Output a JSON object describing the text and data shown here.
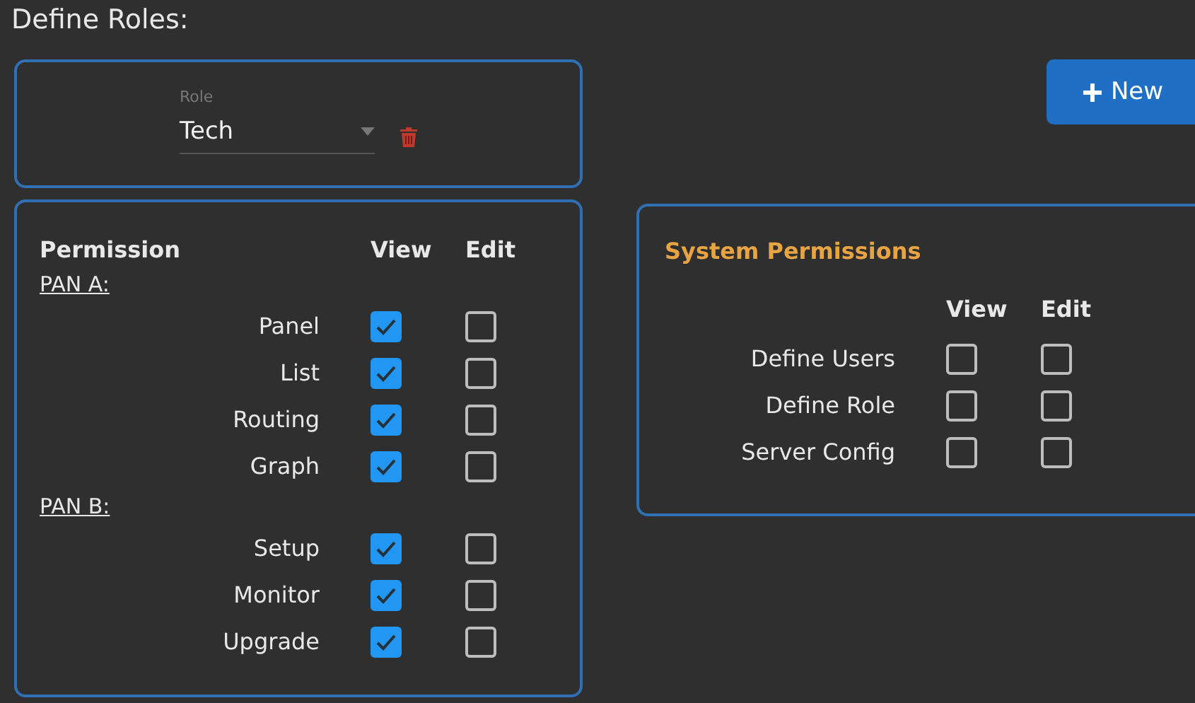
{
  "title": "Define Roles:",
  "role_field": {
    "label": "Role",
    "value": "Tech"
  },
  "new_button": {
    "label": "New"
  },
  "permissions": {
    "columns": [
      "Permission",
      "View",
      "Edit"
    ],
    "groups": [
      {
        "label": "PAN A:",
        "items": [
          {
            "label": "Panel",
            "view": true,
            "edit": false
          },
          {
            "label": "List",
            "view": true,
            "edit": false
          },
          {
            "label": "Routing",
            "view": true,
            "edit": false
          },
          {
            "label": "Graph",
            "view": true,
            "edit": false
          }
        ]
      },
      {
        "label": "PAN B:",
        "items": [
          {
            "label": "Setup",
            "view": true,
            "edit": false
          },
          {
            "label": "Monitor",
            "view": true,
            "edit": false
          },
          {
            "label": "Upgrade",
            "view": true,
            "edit": false
          }
        ]
      }
    ]
  },
  "system_permissions": {
    "title": "System Permissions",
    "columns": [
      "View",
      "Edit"
    ],
    "items": [
      {
        "label": "Define Users",
        "view": false,
        "edit": false
      },
      {
        "label": "Define Role",
        "view": false,
        "edit": false
      },
      {
        "label": "Server Config",
        "view": false,
        "edit": false
      }
    ]
  }
}
